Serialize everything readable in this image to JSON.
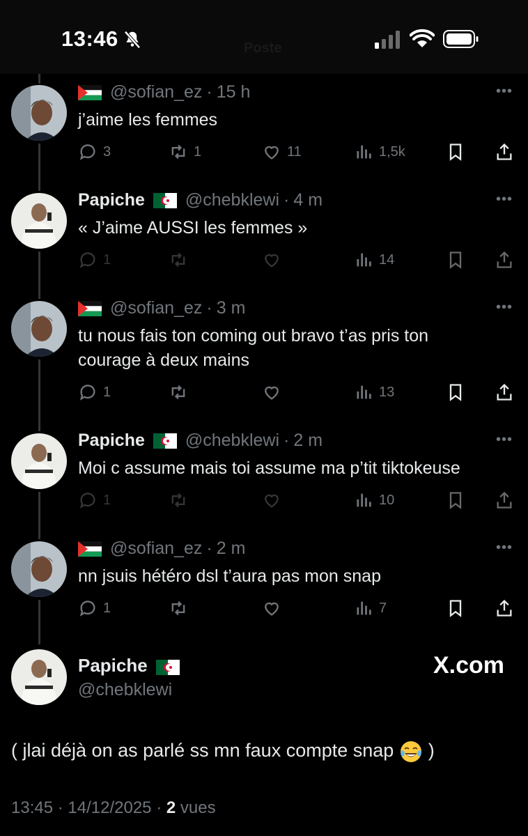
{
  "status_bar": {
    "time": "13:46",
    "icons": [
      "bell-slash-icon",
      "signal-icon",
      "wifi-icon",
      "battery-icon"
    ]
  },
  "header_ghost": "Poste",
  "thread": [
    {
      "name": "",
      "flag": "palestine",
      "handle": "@sofian_ez",
      "dot": "·",
      "ago": "15 h",
      "text": "j’aime les femmes",
      "replies": "3",
      "reposts": "1",
      "likes": "11",
      "views": "1,5k"
    },
    {
      "name": "Papiche",
      "flag": "algeria",
      "handle": "@chebklewi",
      "dot": "·",
      "ago": "4 m",
      "text": "« J’aime AUSSI les femmes »",
      "replies": "1",
      "reposts": "",
      "likes": "",
      "views": "14"
    },
    {
      "name": "",
      "flag": "palestine",
      "handle": "@sofian_ez",
      "dot": "·",
      "ago": "3 m",
      "text": "tu nous fais ton coming out bravo t’as pris ton courage à deux mains",
      "replies": "1",
      "reposts": "",
      "likes": "",
      "views": "13"
    },
    {
      "name": "Papiche",
      "flag": "algeria",
      "handle": "@chebklewi",
      "dot": "·",
      "ago": "2 m",
      "text": "Moi c assume mais toi assume ma p’tit tiktokeuse",
      "replies": "1",
      "reposts": "",
      "likes": "",
      "views": "10"
    },
    {
      "name": "",
      "flag": "palestine",
      "handle": "@sofian_ez",
      "dot": "·",
      "ago": "2 m",
      "text": "nn jsuis hétéro dsl t’aura pas mon snap",
      "replies": "1",
      "reposts": "",
      "likes": "",
      "views": "7"
    }
  ],
  "focus": {
    "name": "Papiche",
    "flag": "algeria",
    "handle": "@chebklewi",
    "watermark": "X.com",
    "text_start": "( jlai déjà on as parlé ss mn faux compte snap",
    "emoji": "tears-of-joy-emoji",
    "text_end": ")",
    "time": "13:45",
    "sep1": "·",
    "date": "14/12/2025",
    "sep2": "·",
    "views_count": "2",
    "views_label": "vues"
  },
  "colors": {
    "background": "#000000",
    "text": "#e7e9ea",
    "secondary": "#71767b",
    "thread_line": "#333639"
  }
}
